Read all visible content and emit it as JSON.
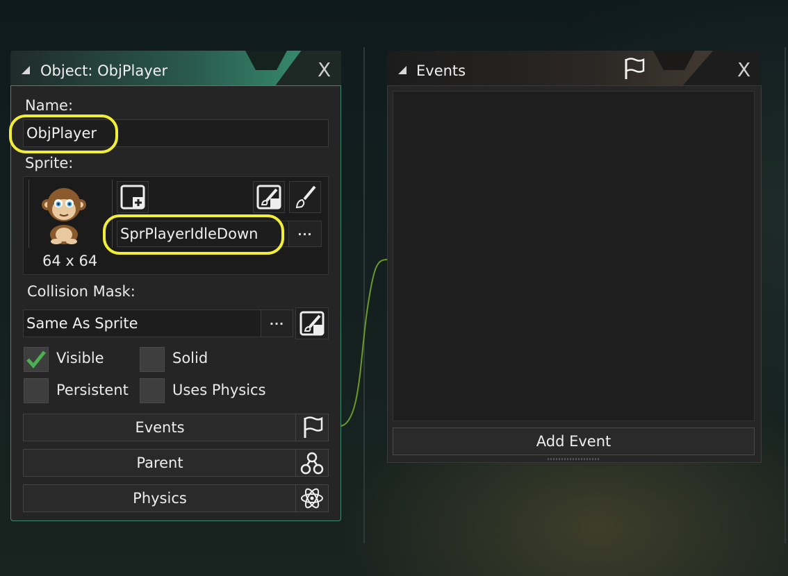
{
  "object_window": {
    "title": "Object: ObjPlayer",
    "name_label": "Name:",
    "name_value": "ObjPlayer",
    "sprite_label": "Sprite:",
    "sprite_name": "SprPlayerIdleDown",
    "sprite_size": "64 x 64",
    "collision_label": "Collision Mask:",
    "collision_value": "Same As Sprite",
    "browse_label": "···",
    "checkboxes": {
      "visible": {
        "label": "Visible",
        "checked": true
      },
      "solid": {
        "label": "Solid",
        "checked": false
      },
      "persistent": {
        "label": "Persistent",
        "checked": false
      },
      "uses_physics": {
        "label": "Uses Physics",
        "checked": false
      }
    },
    "buttons": {
      "events": "Events",
      "parent": "Parent",
      "physics": "Physics"
    },
    "close_label": "X"
  },
  "events_window": {
    "title": "Events",
    "add_event": "Add Event",
    "close_label": "X"
  },
  "colors": {
    "highlight": "#f1ee3a",
    "accent": "#3a9a78",
    "check_green": "#4caf50"
  },
  "icons": [
    "new-sprite-icon",
    "edit-sprite-icon",
    "brush-icon",
    "flag-icon",
    "parent-icon",
    "physics-icon",
    "close-icon"
  ]
}
